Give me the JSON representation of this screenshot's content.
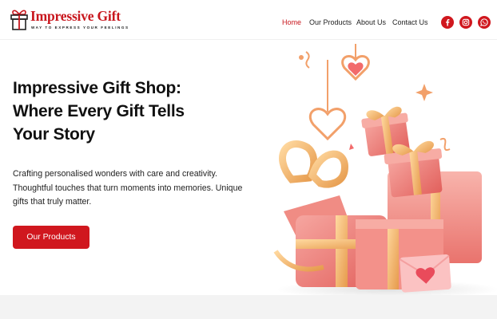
{
  "brand": {
    "name": "Impressive Gift",
    "tagline": "WAY TO EXPRESS YOUR FEELINGS",
    "accent_color": "#d0171e"
  },
  "nav": {
    "items": [
      {
        "label": "Home",
        "active": true
      },
      {
        "label": "Our Products",
        "active": false
      },
      {
        "label": "About Us",
        "active": false
      },
      {
        "label": "Contact Us",
        "active": false
      }
    ]
  },
  "social": {
    "icons": [
      "facebook-icon",
      "instagram-icon",
      "whatsapp-icon"
    ]
  },
  "hero": {
    "title_lines": [
      "Impressive Gift Shop:",
      "Where Every Gift Tells",
      "Your Story"
    ],
    "description_lines": [
      "Crafting personalised wonders with care and creativity.",
      "Thoughtful touches that turn moments into memories. Unique",
      "gifts that truly matter."
    ],
    "cta_label": "Our Products"
  }
}
